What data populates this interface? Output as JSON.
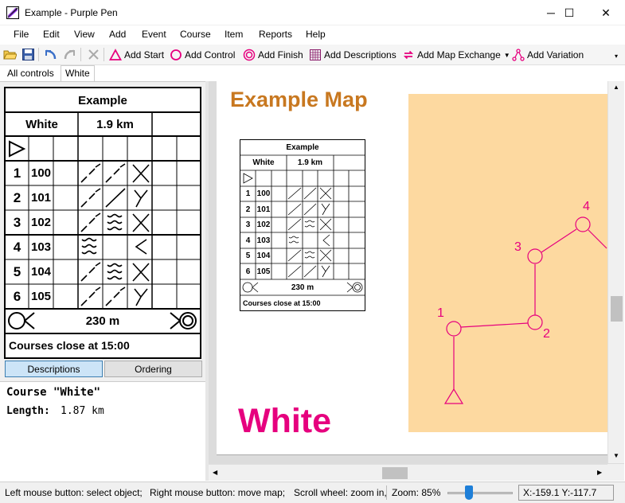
{
  "window": {
    "title": "Example - Purple Pen",
    "minimize": "─",
    "maximize": "☐",
    "close": "✕"
  },
  "menu": [
    "File",
    "Edit",
    "View",
    "Add",
    "Event",
    "Course",
    "Item",
    "Reports",
    "Help"
  ],
  "toolbar": {
    "add_start": "Add Start",
    "add_control": "Add Control",
    "add_finish": "Add Finish",
    "add_descriptions": "Add Descriptions",
    "add_map_exchange": "Add Map Exchange",
    "add_variation": "Add Variation"
  },
  "tabs": [
    "All controls",
    "White"
  ],
  "description_sheet": {
    "event_title": "Example",
    "course_name": "White",
    "course_length": "1.9 km",
    "rows": [
      {
        "seq": "1",
        "code": "100"
      },
      {
        "seq": "2",
        "code": "101"
      },
      {
        "seq": "3",
        "code": "102"
      },
      {
        "seq": "4",
        "code": "103"
      },
      {
        "seq": "5",
        "code": "104"
      },
      {
        "seq": "6",
        "code": "105"
      }
    ],
    "finish_distance": "230 m",
    "footer": "Courses close at 15:00"
  },
  "panel_buttons": {
    "descriptions": "Descriptions",
    "ordering": "Ordering"
  },
  "course_info": {
    "heading": "Course \"White\"",
    "length_label": "Length:",
    "length_value": "1.87 km"
  },
  "map": {
    "title": "Example Map",
    "course_label": "White",
    "control_numbers": [
      "1",
      "2",
      "3",
      "4"
    ],
    "colors": {
      "title": "#c87820",
      "course": "#e6007e",
      "map_bg": "#fdd9a0"
    }
  },
  "status": {
    "left_mouse": "Left mouse button: select object;",
    "right_mouse": "Right mouse button: move map;",
    "scroll_wheel": "Scroll wheel: zoom in,",
    "zoom": "Zoom: 85%",
    "zoom_level": 0.3,
    "coords": "X:-159.1 Y:-117.7"
  }
}
